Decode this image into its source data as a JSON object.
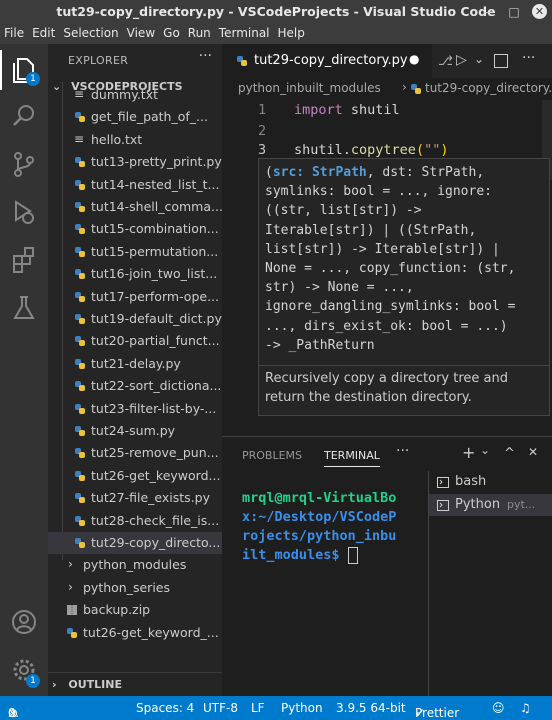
{
  "window": {
    "title": "tut29-copy_directory.py - VSCodeProjects - Visual Studio Code",
    "minimize": "–",
    "restore": "□",
    "close": "✕"
  },
  "menu": [
    "File",
    "Edit",
    "Selection",
    "View",
    "Go",
    "Run",
    "Terminal",
    "Help"
  ],
  "activity": {
    "explorer_badge": "1",
    "accounts_badge": "1"
  },
  "sidebar": {
    "header": "EXPLORER",
    "more": "···",
    "section": "VSCODEPROJECTS",
    "outline": "OUTLINE",
    "files": [
      {
        "name": "dummy.txt",
        "type": "txt"
      },
      {
        "name": "get_file_path_of_...",
        "type": "py"
      },
      {
        "name": "hello.txt",
        "type": "txt"
      },
      {
        "name": "tut13-pretty_print.py",
        "type": "py"
      },
      {
        "name": "tut14-nested_list_t...",
        "type": "py"
      },
      {
        "name": "tut14-shell_comma...",
        "type": "py"
      },
      {
        "name": "tut15-combination...",
        "type": "py"
      },
      {
        "name": "tut15-permutation...",
        "type": "py"
      },
      {
        "name": "tut16-join_two_list...",
        "type": "py"
      },
      {
        "name": "tut17-perform-ope...",
        "type": "py"
      },
      {
        "name": "tut19-default_dict.py",
        "type": "py"
      },
      {
        "name": "tut20-partial_funct...",
        "type": "py"
      },
      {
        "name": "tut21-delay.py",
        "type": "py"
      },
      {
        "name": "tut22-sort_dictiona...",
        "type": "py"
      },
      {
        "name": "tut23-filter-list-by-...",
        "type": "py"
      },
      {
        "name": "tut24-sum.py",
        "type": "py"
      },
      {
        "name": "tut25-remove_pun...",
        "type": "py"
      },
      {
        "name": "tut26-get_keyword...",
        "type": "py"
      },
      {
        "name": "tut27-file_exists.py",
        "type": "py"
      },
      {
        "name": "tut28-check_file_is...",
        "type": "py"
      },
      {
        "name": "tut29-copy_directo...",
        "type": "py",
        "selected": true
      }
    ],
    "folders": [
      "python_modules",
      "python_series"
    ],
    "root_files": [
      {
        "name": "backup.zip",
        "type": "zip"
      },
      {
        "name": "tut26-get_keyword_...",
        "type": "py"
      }
    ]
  },
  "editor": {
    "tab_label": "tut29-copy_directory.py",
    "breadcrumb_folder": "python_inbuilt_modules",
    "breadcrumb_sep": "›",
    "breadcrumb_file": "tut29-copy_directory.",
    "lines": [
      "1",
      "2",
      "3"
    ],
    "code": {
      "l1_kw": "import",
      "l1_rest": " shutil",
      "l3_obj": "shutil.",
      "l3_fn": "copytree",
      "l3_paren": "(",
      "l3_str": "\"\"",
      "l3_close": ")"
    },
    "hover": {
      "signature": [
        "(src: StrPath, dst: StrPath,",
        "symlinks: bool = ..., ignore:",
        "((str, list[str]) ->",
        "Iterable[str]) | ((StrPath,",
        "list[str]) -> Iterable[str]) |",
        "None = ..., copy_function: (str,",
        "str) -> None = ...,",
        "ignore_dangling_symlinks: bool =",
        "..., dirs_exist_ok: bool = ...)",
        "-> _PathReturn"
      ],
      "doc": "Recursively copy a directory tree and return the destination directory."
    }
  },
  "panel": {
    "tabs": [
      "PROBLEMS",
      "TERMINAL"
    ],
    "more": "···",
    "add": "+",
    "dropdown": "⌄",
    "maximize": "^",
    "close": "✕",
    "terminal_lines": [
      "mrql@mrql-VirtualBo",
      "x:~/Desktop/VSCodeP",
      "rojects/python_inbu",
      "ilt_modules$ "
    ],
    "terminals": [
      {
        "name": "bash",
        "extra": ""
      },
      {
        "name": "Python",
        "extra": "pyt..."
      }
    ]
  },
  "statusbar": {
    "errors": "0",
    "warnings": "0",
    "spaces": "Spaces: 4",
    "encoding": "UTF-8",
    "eol": "LF",
    "language": "Python",
    "interpreter": "3.9.5 64-bit",
    "prettier": "Prettier"
  },
  "colors": {
    "accent": "#007acc",
    "keyword": "#c586c0",
    "function": "#dcdcaa",
    "string": "#ce9178",
    "prompt_user": "#23d18b",
    "prompt_path": "#3b8eea"
  }
}
